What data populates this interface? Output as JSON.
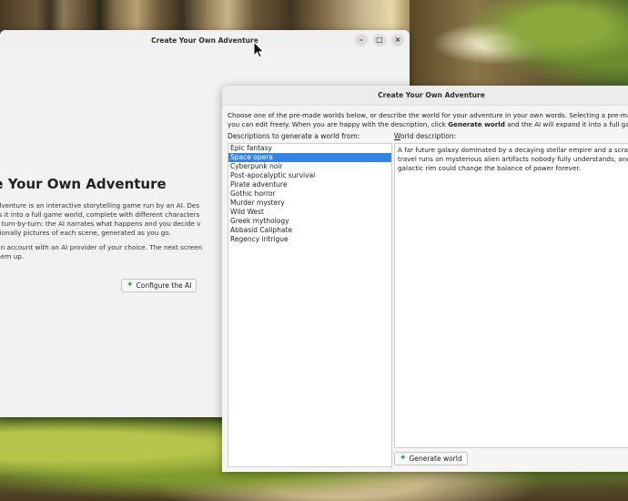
{
  "back_window": {
    "title": "Create Your Own Adventure",
    "controls": {
      "minimize": "–",
      "maximize": "□",
      "close": "×"
    },
    "heading": "ate Your Own Adventure",
    "paragraphs": [
      [
        "Your Own Adventure is an interactive storytelling game run by an AI. Des",
        "e AI expands it into a full game world, complete with different characters",
        "e adventure turn-by-turn: the AI narrates what happens and you decide v",
        "ery, and optionally pictures of each scene, generated as you go."
      ],
      [
        ", you need an account with an AI provider of your choice. The next screen",
        "lp you set them up."
      ]
    ],
    "configure_button": "Configure the AI"
  },
  "front_window": {
    "title": "Create Your Own Adventure",
    "intro_line1": "Choose one of the pre-made worlds below, or describe the world for your adventure in your own words. Selecting a pre-made world",
    "intro_line2_a": "you can edit freely. When you are happy with the description, click ",
    "intro_line2_bold": "Generate world",
    "intro_line2_b": " and the AI will expand it into a full game world",
    "list_label": "Descriptions to generate a world from:",
    "desc_label_first": "W",
    "desc_label_rest": "orld description:",
    "worlds": [
      "Epic fantasy",
      "Space opera",
      "Cyberpunk noir",
      "Post-apocalyptic survival",
      "Pirate adventure",
      "Gothic horror",
      "Murder mystery",
      "Wild West",
      "Greek mythology",
      "Abbasid Caliphate",
      "Regency intrigue"
    ],
    "selected_index": 1,
    "description_lines": [
      "A far future galaxy dominated by a decaying stellar empire and a scrappy re",
      "travel runs on mysterious alien artifacts nobody fully understands, and a ne",
      "galactic rim could change the balance of power forever."
    ],
    "generate_button": "Generate world"
  },
  "colors": {
    "selection": "#3584e4",
    "accent_icon": "#2c9a4a"
  },
  "icons": {
    "button_icon": "sparkle-icon"
  }
}
